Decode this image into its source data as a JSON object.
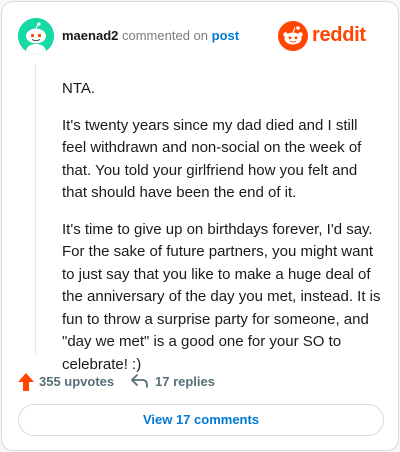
{
  "comment": {
    "username": "maenad2",
    "commented_on_text": "commented on",
    "post_link_text": "post",
    "paragraphs": [
      "NTA.",
      "It's twenty years since my dad died and I still feel withdrawn and non-social on the week of that. You told your girlfriend how you felt and that should have been the end of it.",
      "It's time to give up on birthdays forever, I'd say. For the sake of future partners, you might want to just say that you like to make a huge deal of the anniversary of the day you met, instead. It is fun to throw a surprise party for someone, and \"day we met\" is a good one for your SO to celebrate! :)"
    ]
  },
  "brand": {
    "name": "reddit",
    "icon": "reddit-logo-icon",
    "color": "#ff4500"
  },
  "actions": {
    "upvotes_label": "355 upvotes",
    "replies_label": "17 replies"
  },
  "view_comments_label": "View 17 comments",
  "colors": {
    "avatar_bg": "#17d9a3",
    "upvote_arrow": "#ff4500",
    "link_blue": "#0079d3"
  }
}
